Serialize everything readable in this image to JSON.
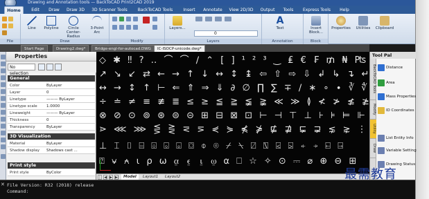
{
  "titlebar": {
    "text": "Drawing and Annotation tools — BackToCAD Print2CAD 2019"
  },
  "ribbon_tabs": [
    "Home",
    "Edit",
    "Draw",
    "Draw 3D",
    "3D Scanner Tools",
    "BackToCAD Tools",
    "Insert",
    "Annotate",
    "View 2D/3D",
    "Output",
    "Tools",
    "Express Tools",
    "Help"
  ],
  "ribbon": {
    "groups": [
      {
        "label": "File"
      },
      {
        "label": "Draw"
      },
      {
        "label": "Modify"
      },
      {
        "label": "Layers"
      },
      {
        "label": "Annotation"
      },
      {
        "label": "Block"
      }
    ],
    "buttons": {
      "line": "Line",
      "polyline": "Polyline",
      "circle": "Circle\nCenter-Radius",
      "arc": "3-Point\nArc",
      "layers": "Layers...",
      "text": "Text",
      "insert": "Insert\nBlock...",
      "properties": "Properties",
      "utilities": "Utilities",
      "clipboard": "Clipboard"
    },
    "layer_value": "0"
  },
  "doc_tabs": [
    "Start Page",
    "Drawing2.dwg*",
    "Bridge-engl-for-autocad.DWG",
    "IC-ISOCP-unicode.dwg*"
  ],
  "properties": {
    "title": "Properties",
    "selection": "No selection",
    "general": {
      "header": "General",
      "rows": [
        {
          "k": "Color",
          "v": "ByLayer"
        },
        {
          "k": "Layer",
          "v": "0"
        },
        {
          "k": "Linetype",
          "v": "——— ByLayer"
        },
        {
          "k": "Linetype scale",
          "v": "1.0000"
        },
        {
          "k": "Lineweight",
          "v": "——— ByLayer"
        },
        {
          "k": "Thickness",
          "v": "0"
        },
        {
          "k": "Transparency",
          "v": "ByLayer"
        }
      ]
    },
    "viz3d": {
      "header": "3D Visualization",
      "rows": [
        {
          "k": "Material",
          "v": "ByLayer"
        },
        {
          "k": "Shadow display",
          "v": "Shadows cast ..."
        }
      ]
    },
    "print": {
      "header": "Print style",
      "rows": [
        {
          "k": "Print style",
          "v": "ByColor"
        }
      ]
    }
  },
  "canvas": {
    "rows": [
      "◇ ✱ ‼ ? ‥ ⌒ ⌒ ∕ ⌃ [ ] ¹ ² ³ ‿ ₤ € ₣ ₥ ₦ ₧ ₨ ₩ ₪ ₫ ₯",
      "↗ ↘ ↙ ⇄ ← → ↑ ↓ ↔ ↕ ↨ ⇦ ⇧ ⇨ ⇩ ↲ ↳ ↴ ↵ ↶ ↷",
      "↔ → ↕ ↑ ⊢ ⇐ ⇑ ⇒ ⇓ ∂ ∅ ∏ ∑ ∓ ∕ ∗ ∘ ∙ ∛ ∜ ∝ ∟ ∧ ∨ ∩ ∪",
      "÷ ≐ ≠ ≡ ≢ ≣ ≤ ≥ ≦ ≧ ≨ ≩ ≪ ≫ ≬ ≮ ≯ ≰ ≱ ≲ ≳ ≴",
      "⊗ ⊘ ⊙ ⊚ ⊛ ⊜ ⊝ ⊞ ⊟ ⊠ ⊡ ⊢ ⊣ ⊤ ⊥ ⊦ ⊧ ⊨ ⊩ ⊪ ⊫ ⊬",
      "⋗ ⋘ ⋙ ⋚ ⋛ ⋜ ⋝ ⋞ ⋟ ⋠ ⋡ ⋢ ⋣ ⋤ ⋥ ⋦ ⋧ ⋮ ⋯ ⋰",
      "⊥ ⌶ ⌷ ⌸ ⌹ ⌺ ⌻ ⌼ ⌽ ⌾ ⌿ ⍀ ⍁ ⍂ ⍃ ⍄ ⍅ ⍆ ⍇ ⍈",
      "⍰ ⍱ ⍲ ⍳ ⍴ ⍵ ⍶ ⍷ ⍸ ⍹ ⍺ ⎕ ☆ ✧ ⊙ ⎓ ⌀ ⊕ ⊖ ⊞"
    ]
  },
  "layout_tabs": [
    "Model",
    "Layout1",
    "Layout2"
  ],
  "tool_palette": {
    "title": "Tool Pal",
    "vtabs": [
      "BackToCAD Tools",
      "Modify",
      "Utility",
      "Draw"
    ],
    "items": [
      "Distance",
      "Area",
      "Mass Properties",
      "ID Coordinates",
      "List Entity Info",
      "Variable Setting",
      "Drawing Status"
    ]
  },
  "command": {
    "line1": "File Version: R32 (2018) release",
    "line2": "Command:"
  },
  "watermark": "最需教育",
  "colors": {
    "ribbon_tab_bg": "#2d5a97",
    "canvas_bg": "#050505",
    "section_bg": "#3a3a3a",
    "active_vtab": "#f1c232"
  }
}
